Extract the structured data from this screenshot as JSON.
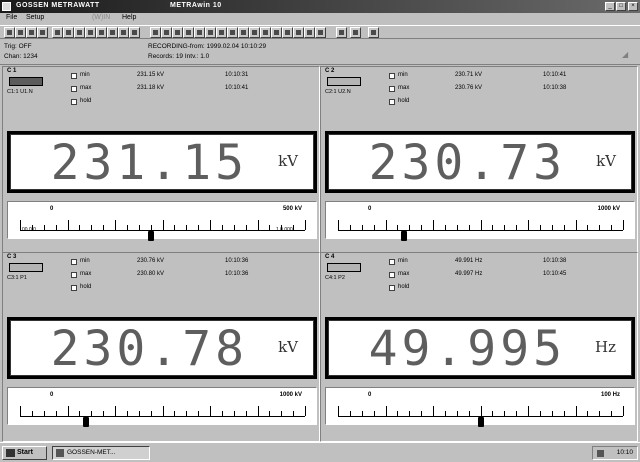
{
  "window": {
    "title_left": "GOSSEN METRAWATT",
    "title_right": "METRAwin 10",
    "buttons": [
      "_",
      "□",
      "×"
    ]
  },
  "menu": [
    {
      "label": "File",
      "enabled": true
    },
    {
      "label": "Setup",
      "enabled": true
    },
    {
      "label": "(W)IN",
      "enabled": false
    },
    {
      "label": "Help",
      "enabled": true
    }
  ],
  "info": {
    "trig": "Trig: OFF",
    "chan": "Chan: 1234",
    "rec_date": "RECORDING-from: 1999.02.04 10:10:29",
    "records": "Records: 19   Intv.: 1.0"
  },
  "panels": [
    {
      "channel": "C 1",
      "sub": "C1:1 U1.N",
      "badge": "dark",
      "min_label": "min",
      "min_value": "231.15 kV",
      "min_time": "10:10:31",
      "max_label": "max",
      "max_value": "231.18 kV",
      "max_time": "10:10:41",
      "hold_label": "hold",
      "reading": "231.15",
      "unit": "kV",
      "scale_min": "0",
      "scale_max": "500 kV",
      "edge_left": "00.0.0",
      "edge_right": "1.0.000",
      "level": 0.46
    },
    {
      "channel": "C 2",
      "sub": "C2:1 U2.N",
      "badge": "light",
      "min_label": "min",
      "min_value": "230.71 kV",
      "min_time": "10:10:41",
      "max_label": "max",
      "max_value": "230.76 kV",
      "max_time": "10:10:38",
      "hold_label": "hold",
      "reading": "230.73",
      "unit": "kV",
      "scale_min": "0",
      "scale_max": "1000 kV",
      "edge_left": "",
      "edge_right": "",
      "level": 0.23
    },
    {
      "channel": "C 3",
      "sub": "C3:1 P1",
      "badge": "light",
      "min_label": "min",
      "min_value": "230.76 kV",
      "min_time": "10:10:36",
      "max_label": "max",
      "max_value": "230.80 kV",
      "max_time": "10:10:36",
      "hold_label": "hold",
      "reading": "230.78",
      "unit": "kV",
      "scale_min": "0",
      "scale_max": "1000 kV",
      "edge_left": "",
      "edge_right": "",
      "level": 0.23
    },
    {
      "channel": "C 4",
      "sub": "C4:1 P2",
      "badge": "light",
      "min_label": "min",
      "min_value": "49.991 Hz",
      "min_time": "10:10:38",
      "max_label": "max",
      "max_value": "49.997 Hz",
      "max_time": "10:10:45",
      "hold_label": "hold",
      "reading": "49.995",
      "unit": "Hz",
      "scale_min": "0",
      "scale_max": "100 Hz",
      "edge_left": "",
      "edge_right": "",
      "level": 0.5
    }
  ],
  "taskbar": {
    "start": "Start",
    "task": "GOSSEN-MET...",
    "clock": "10:10"
  }
}
